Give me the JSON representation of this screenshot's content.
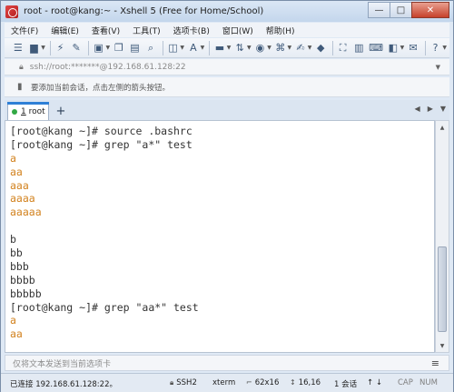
{
  "window": {
    "title": "root - root@kang:~ - Xshell 5 (Free for Home/School)",
    "buttons": {
      "minimize": "—",
      "maximize": "□",
      "close": "✕"
    }
  },
  "menu": [
    "文件(F)",
    "编辑(E)",
    "查看(V)",
    "工具(T)",
    "选项卡(B)",
    "窗口(W)",
    "帮助(H)"
  ],
  "address": {
    "text": "ssh://root:*******@192.168.61.128:22"
  },
  "hint": {
    "text": "要添加当前会话，点击左侧的箭头按钮。"
  },
  "tabs": [
    {
      "number": "1",
      "label": "root",
      "active": true
    }
  ],
  "tab_add": "+",
  "terminal": {
    "lines": [
      {
        "type": "cmd",
        "text": "[root@kang ~]# source .bashrc"
      },
      {
        "type": "cmd",
        "text": "[root@kang ~]# grep \"a*\" test"
      },
      {
        "type": "match",
        "text": "a"
      },
      {
        "type": "match",
        "text": "aa"
      },
      {
        "type": "match",
        "text": "aaa"
      },
      {
        "type": "match",
        "text": "aaaa"
      },
      {
        "type": "match",
        "text": "aaaaa"
      },
      {
        "type": "plain",
        "text": ""
      },
      {
        "type": "plain",
        "text": "b"
      },
      {
        "type": "plain",
        "text": "bb"
      },
      {
        "type": "plain",
        "text": "bbb"
      },
      {
        "type": "plain",
        "text": "bbbb"
      },
      {
        "type": "plain",
        "text": "bbbbb"
      },
      {
        "type": "cmd",
        "text": "[root@kang ~]# grep \"aa*\" test"
      },
      {
        "type": "match",
        "text": "a"
      },
      {
        "type": "match",
        "text": "aa"
      }
    ],
    "colors": {
      "match": "#d2821e",
      "text": "#333333"
    }
  },
  "compose": {
    "placeholder": "仅将文本发送到当前选项卡"
  },
  "status": {
    "connection": "已连接 192.168.61.128:22。",
    "protocol": "SSH2",
    "terminal_type": "xterm",
    "size": "62x16",
    "cursor": "16,16",
    "sessions": "1 会话",
    "caps": "CAP",
    "num": "NUM"
  }
}
